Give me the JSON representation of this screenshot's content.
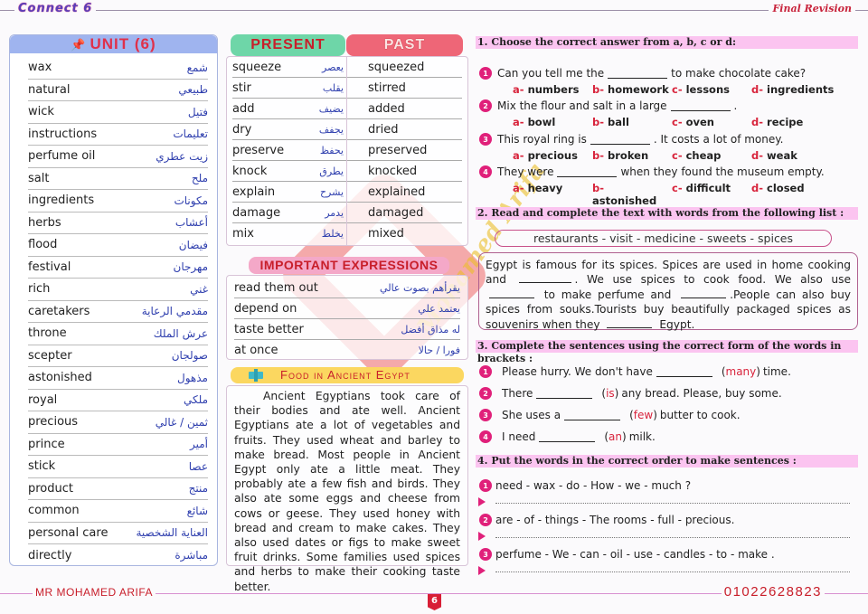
{
  "header": {
    "brand": "Connect 6",
    "title": "Final Revision"
  },
  "vocab": {
    "title": "UNIT (6)",
    "items": [
      {
        "en": "wax",
        "ar": "شمع"
      },
      {
        "en": "natural",
        "ar": "طبيعي"
      },
      {
        "en": "wick",
        "ar": "فتيل"
      },
      {
        "en": "instructions",
        "ar": "تعليمات"
      },
      {
        "en": "perfume oil",
        "ar": "زيت عطري"
      },
      {
        "en": "salt",
        "ar": "ملح"
      },
      {
        "en": "ingredients",
        "ar": "مكونات"
      },
      {
        "en": "herbs",
        "ar": "أعشاب"
      },
      {
        "en": "flood",
        "ar": "فيضان"
      },
      {
        "en": "festival",
        "ar": "مهرجان"
      },
      {
        "en": "rich",
        "ar": "غني"
      },
      {
        "en": "caretakers",
        "ar": "مقدمي الرعاية"
      },
      {
        "en": "throne",
        "ar": "عرش الملك"
      },
      {
        "en": "scepter",
        "ar": "صولجان"
      },
      {
        "en": "astonished",
        "ar": "مذهول"
      },
      {
        "en": "royal",
        "ar": "ملكي"
      },
      {
        "en": "precious",
        "ar": "ثمين / غالي"
      },
      {
        "en": "prince",
        "ar": "أمير"
      },
      {
        "en": "stick",
        "ar": "عصا"
      },
      {
        "en": "product",
        "ar": "منتج"
      },
      {
        "en": "common",
        "ar": "شائع"
      },
      {
        "en": "personal care",
        "ar": "العناية الشخصية"
      },
      {
        "en": "directly",
        "ar": "مباشرة"
      }
    ]
  },
  "verbs": {
    "present_label": "PRESENT",
    "past_label": "PAST",
    "rows": [
      {
        "present": "squeeze",
        "ar": "يعصر",
        "past": "squeezed"
      },
      {
        "present": "stir",
        "ar": "يقلب",
        "past": "stirred"
      },
      {
        "present": "add",
        "ar": "يضيف",
        "past": "added"
      },
      {
        "present": "dry",
        "ar": "يجفف",
        "past": "dried"
      },
      {
        "present": "preserve",
        "ar": "يحفظ",
        "past": "preserved"
      },
      {
        "present": "knock",
        "ar": "يطرق",
        "past": "knocked"
      },
      {
        "present": "explain",
        "ar": "يشرح",
        "past": "explained"
      },
      {
        "present": "damage",
        "ar": "يدمر",
        "past": "damaged"
      },
      {
        "present": "mix",
        "ar": "يخلط",
        "past": "mixed"
      }
    ]
  },
  "expressions": {
    "title": "IMPORTANT EXPRESSIONS",
    "rows": [
      {
        "en": "read them out",
        "ar": "يقرأهم بصوت عالي"
      },
      {
        "en": "depend on",
        "ar": "يعتمد علي"
      },
      {
        "en": "taste better",
        "ar": "له مذاق أفضل"
      },
      {
        "en": "at once",
        "ar": "فورا / حالا"
      }
    ]
  },
  "food": {
    "title": "Food in Ancient Egypt",
    "text": "Ancient Egyptians took care of their bodies and ate well. Ancient Egyptians ate a lot of vegetables and fruits. They used wheat and barley to make bread. Most people in Ancient Egypt only ate a little meat. They probably ate a few fish and birds. They also ate some eggs and cheese from cows or geese. They used honey with bread and cream to make cakes. They also used dates or figs to make sweet fruit drinks. Some families used spices and herbs to make their cooking taste better."
  },
  "section1": {
    "title": "1. Choose the correct answer from a, b, c or d:",
    "questions": [
      {
        "n": "1",
        "before": "Can you tell me the",
        "after": "to make chocolate cake?",
        "options": [
          "numbers",
          "homework",
          "lessons",
          "ingredients"
        ]
      },
      {
        "n": "2",
        "before": "Mix the flour and salt in a large",
        "after": ".",
        "options": [
          "bowl",
          "ball",
          "oven",
          "recipe"
        ]
      },
      {
        "n": "3",
        "before": "This royal ring is",
        "after": ". It costs a lot of money.",
        "options": [
          "precious",
          "broken",
          "cheap",
          "weak"
        ]
      },
      {
        "n": "4",
        "before": "They were",
        "after": "when they found the museum empty.",
        "options": [
          "heavy",
          "astonished",
          "difficult",
          "closed"
        ]
      }
    ],
    "letters": [
      "a-",
      "b-",
      "c-",
      "d-"
    ]
  },
  "section2": {
    "title": "2. Read and complete the text with words from the following list :",
    "word_list": "restaurants - visit - medicine - sweets - spices",
    "passage": {
      "p1": "Egypt is famous for its spices. Spices are used in home cooking and",
      "p2": ". We use spices to cook food. We also use",
      "p3": "to make perfume and",
      "p4": ".People can also buy spices from souks.Tourists buy beautifully packaged spices as souvenirs when they",
      "p5": "Egypt."
    }
  },
  "section3": {
    "title": "3. Complete the sentences using the correct form of the words in brackets :",
    "items": [
      {
        "n": "1",
        "before": "Please hurry. We don't have",
        "word": "many",
        "after": "time."
      },
      {
        "n": "2",
        "before": "There",
        "word": "is",
        "after": "any bread. Please, buy some."
      },
      {
        "n": "3",
        "before": "She uses a",
        "word": "few",
        "after": "butter to cook."
      },
      {
        "n": "4",
        "before": "I need",
        "word": "an",
        "after": "milk."
      }
    ]
  },
  "section4": {
    "title": "4. Put the words in the correct order to make sentences :",
    "items": [
      {
        "n": "1",
        "words": "need - wax - do - How - we - much ?"
      },
      {
        "n": "2",
        "words": "are - of - things - The rooms - full - precious."
      },
      {
        "n": "3",
        "words": "perfume - We - can - oil - use - candles - to  - make ."
      }
    ]
  },
  "footer": {
    "author": "Mr Mohamed Arifa",
    "phone": "01022628823",
    "page": "6"
  },
  "watermark": {
    "signature": "Mohamed Arifa"
  }
}
